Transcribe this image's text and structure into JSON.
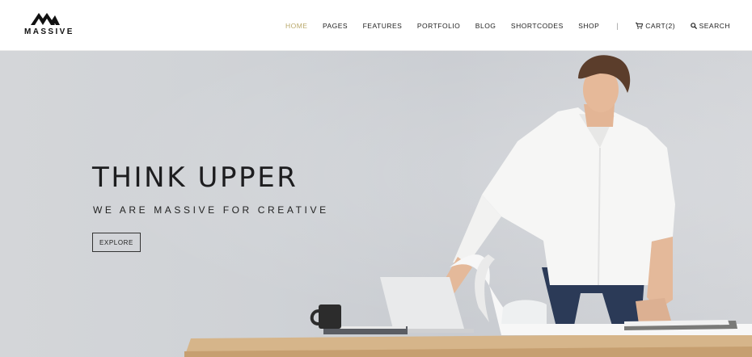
{
  "brand": {
    "name": "MASSIVE"
  },
  "nav": {
    "items": [
      {
        "label": "HOME",
        "active": true
      },
      {
        "label": "PAGES"
      },
      {
        "label": "FEATURES"
      },
      {
        "label": "PORTFOLIO"
      },
      {
        "label": "BLOG"
      },
      {
        "label": "SHORTCODES"
      },
      {
        "label": "SHOP"
      }
    ],
    "separator": "|",
    "cart_label": "CART(2)",
    "search_label": "SEARCH"
  },
  "hero": {
    "title": "THINK UPPER",
    "subtitle": "WE ARE MASSIVE FOR CREATIVE",
    "cta_label": "EXPLORE"
  },
  "colors": {
    "accent": "#b9a86a",
    "text": "#222222",
    "hero_bg": "#cfd2d6"
  },
  "icons": [
    "massive-logo-icon",
    "cart-icon",
    "search-icon"
  ]
}
